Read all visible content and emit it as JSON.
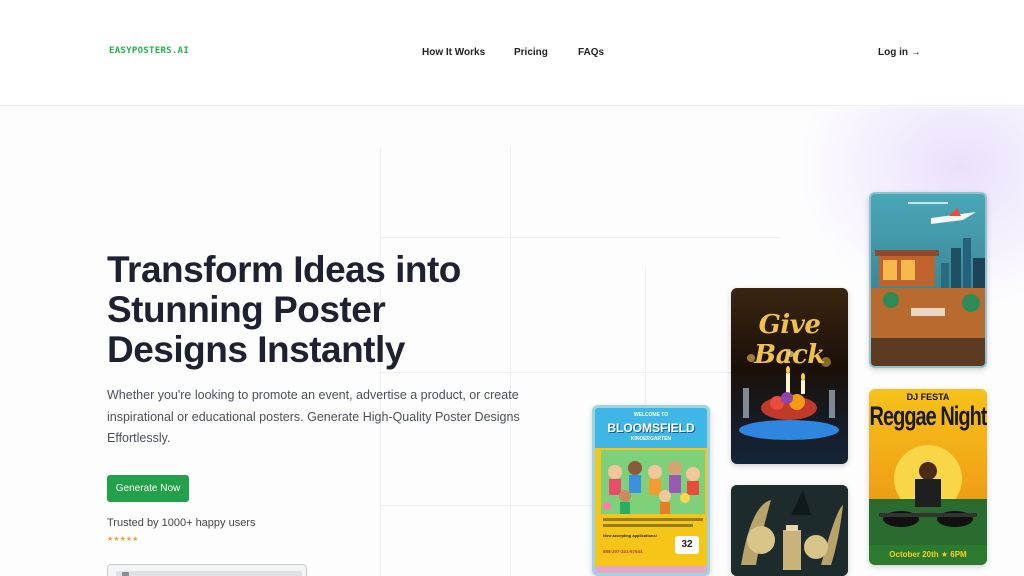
{
  "header": {
    "logo": "EASYPOSTERS.AI",
    "nav": [
      "How It Works",
      "Pricing",
      "FAQs"
    ],
    "login": "Log in →"
  },
  "hero": {
    "headline": [
      "Transform Ideas into",
      "Stunning Poster",
      "Designs Instantly"
    ],
    "subtext": "Whether you're looking to promote an event, advertise a product, or create inspirational or educational posters. Generate High-Quality Poster Designs Effortlessly.",
    "cta_label": "Generate Now",
    "trusted": "Trusted by 1000+ happy users",
    "rating_stars": 5
  },
  "posters": {
    "kindergarten": {
      "welcome": "WELCOME TO",
      "title": "BLOOMSFIELD",
      "subtitle": "KINDERGARTEN",
      "enrolling": "Now accepting applications!",
      "phone": "888-207-331-57644",
      "number": "32"
    },
    "giveback": {
      "title": "Give Back"
    },
    "reggae": {
      "top": "DJ FESTA",
      "title": "Reggae Night",
      "date": "October 20th ★ 6PM"
    }
  },
  "colors": {
    "brand_green": "#22a04a",
    "logo_green": "#22b14c",
    "star_orange": "#f2a038"
  }
}
